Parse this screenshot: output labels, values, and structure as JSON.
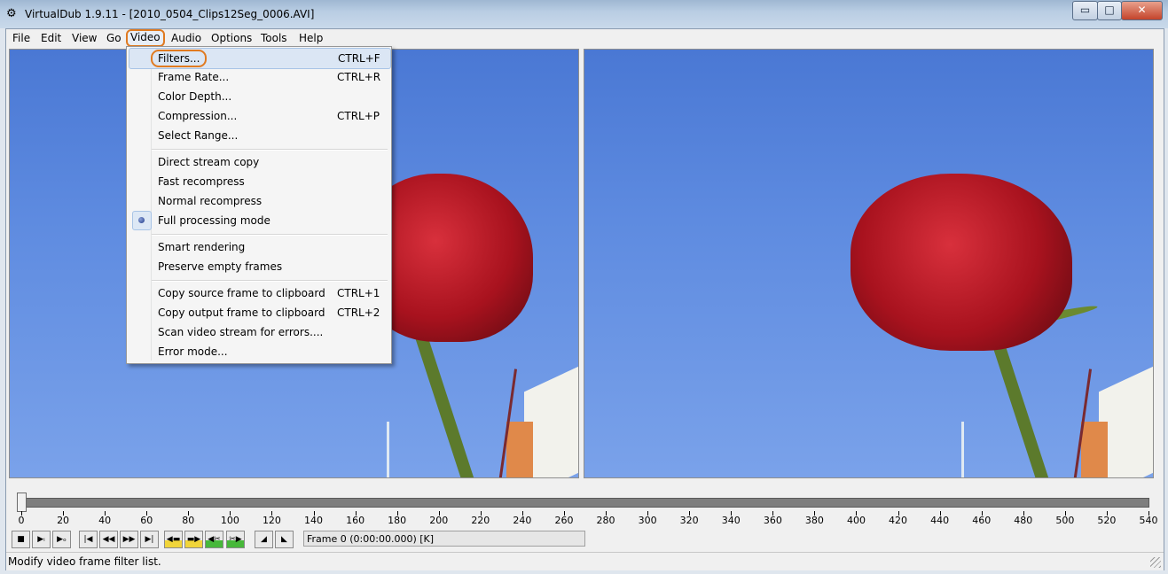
{
  "window": {
    "title": "VirtualDub 1.9.11 - [2010_0504_Clips12Seg_0006.AVI]",
    "icon": "film-gear-icon",
    "controls": {
      "minimize": "▭",
      "maximize": "□",
      "close": "✕"
    }
  },
  "menubar": {
    "items": [
      {
        "label": "File"
      },
      {
        "label": "Edit"
      },
      {
        "label": "View"
      },
      {
        "label": "Go"
      },
      {
        "label": "Video",
        "active": true
      },
      {
        "label": "Audio"
      },
      {
        "label": "Options"
      },
      {
        "label": "Tools"
      },
      {
        "label": "Help"
      }
    ]
  },
  "video_menu": {
    "items": [
      {
        "label": "Filters...",
        "shortcut": "CTRL+F",
        "highlighted": true
      },
      {
        "label": "Frame Rate...",
        "shortcut": "CTRL+R"
      },
      {
        "label": "Color Depth...",
        "shortcut": ""
      },
      {
        "label": "Compression...",
        "shortcut": "CTRL+P"
      },
      {
        "label": "Select Range...",
        "shortcut": ""
      },
      {
        "label": "Direct stream copy",
        "shortcut": ""
      },
      {
        "label": "Fast recompress",
        "shortcut": ""
      },
      {
        "label": "Normal recompress",
        "shortcut": ""
      },
      {
        "label": "Full processing mode",
        "shortcut": "",
        "selected": true
      },
      {
        "label": "Smart rendering",
        "shortcut": ""
      },
      {
        "label": "Preserve empty frames",
        "shortcut": ""
      },
      {
        "label": "Copy source frame to clipboard",
        "shortcut": "CTRL+1"
      },
      {
        "label": "Copy output frame to clipboard",
        "shortcut": "CTRL+2"
      },
      {
        "label": "Scan video stream for errors....",
        "shortcut": ""
      },
      {
        "label": "Error mode...",
        "shortcut": ""
      }
    ]
  },
  "timeline": {
    "min": 0,
    "max": 540,
    "position": 0,
    "tick_labels": [
      "0",
      "20",
      "40",
      "60",
      "80",
      "100",
      "120",
      "140",
      "160",
      "180",
      "200",
      "220",
      "240",
      "260",
      "280",
      "300",
      "320",
      "340",
      "360",
      "380",
      "400",
      "420",
      "440",
      "460",
      "480",
      "500",
      "520",
      "540"
    ]
  },
  "transport": {
    "buttons": [
      {
        "name": "stop-icon",
        "glyph": "■"
      },
      {
        "name": "play-input-icon",
        "glyph": "▶ᵢ"
      },
      {
        "name": "play-output-icon",
        "glyph": "▶ₒ"
      },
      {
        "name": "go-start-icon",
        "glyph": "|◀"
      },
      {
        "name": "step-back-icon",
        "glyph": "◀◀"
      },
      {
        "name": "step-forward-icon",
        "glyph": "▶▶"
      },
      {
        "name": "go-end-icon",
        "glyph": "▶|"
      },
      {
        "name": "prev-keyframe-icon",
        "glyph": "◀▬"
      },
      {
        "name": "next-keyframe-icon",
        "glyph": "▬▶"
      },
      {
        "name": "prev-scene-icon",
        "glyph": "◀✂"
      },
      {
        "name": "next-scene-icon",
        "glyph": "✂▶"
      },
      {
        "name": "mark-in-icon",
        "glyph": "◢"
      },
      {
        "name": "mark-out-icon",
        "glyph": "◣"
      }
    ],
    "frame_status": "Frame 0 (0:00:00.000) [K]"
  },
  "statusbar": {
    "text": "Modify video frame filter list."
  }
}
